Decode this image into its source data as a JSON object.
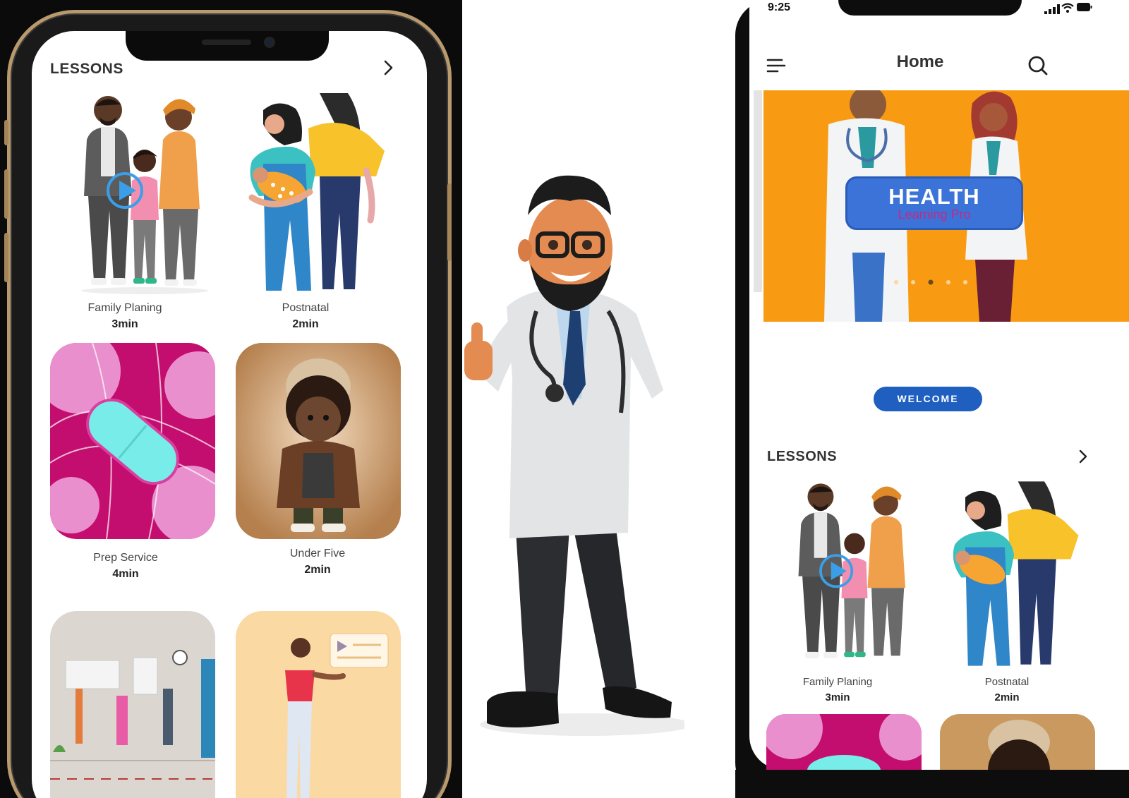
{
  "left_phone": {
    "section_title": "LESSONS",
    "lessons": [
      {
        "name": "Family Planing",
        "duration": "3min"
      },
      {
        "name": "Postnatal",
        "duration": "2min"
      },
      {
        "name": "Prep Service",
        "duration": "4min"
      },
      {
        "name": "Under Five",
        "duration": "2min"
      }
    ]
  },
  "right_phone": {
    "status_time": "9:25",
    "title": "Home",
    "banner": {
      "title": "HEALTH",
      "subtitle": "Learning Pro",
      "active_dot": 3,
      "dot_count": 5
    },
    "welcome_label": "WELCOME",
    "section_title": "LESSONS",
    "lessons": [
      {
        "name": "Family Planing",
        "duration": "3min"
      },
      {
        "name": "Postnatal",
        "duration": "2min"
      }
    ]
  },
  "colors": {
    "accent_blue": "#1f5fc0",
    "banner_orange": "#f89a12",
    "play_icon": "#3a9fe8",
    "pink_card": "#c40e6f"
  },
  "icons": [
    "menu-icon",
    "search-icon",
    "chevron-right-icon",
    "play-icon",
    "signal-icon",
    "wifi-icon",
    "battery-icon"
  ]
}
